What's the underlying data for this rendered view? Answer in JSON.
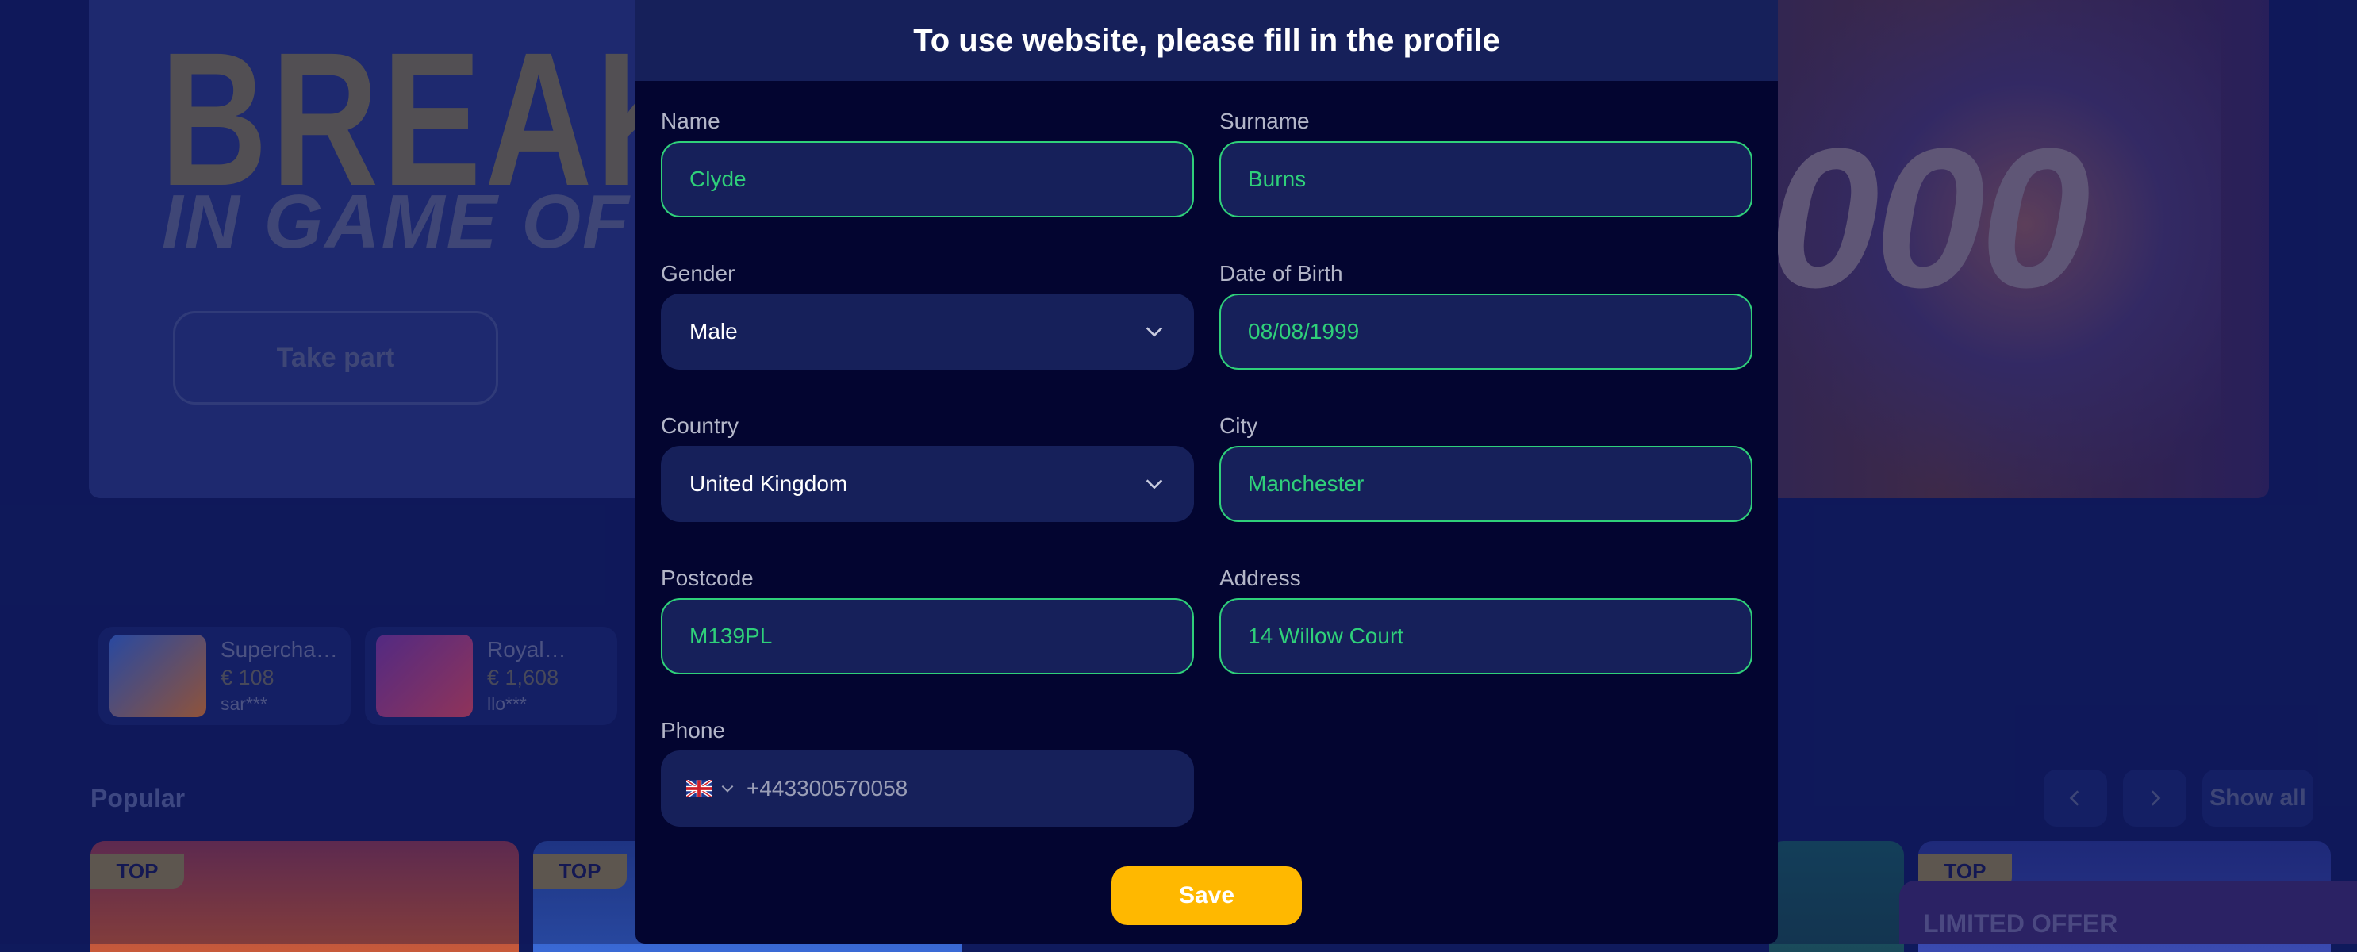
{
  "background": {
    "banner": {
      "title_line1": "BREAK T",
      "title_line2": "IN GAME OF T",
      "cta_label": "Take part",
      "amount_text": "000"
    },
    "winners": [
      {
        "name": "Supercharg…",
        "amount": "€ 108",
        "user": "sar***"
      },
      {
        "name": "Royal…",
        "amount": "€ 1,608",
        "user": "llo***"
      }
    ],
    "popular": {
      "title": "Popular",
      "show_all_label": "Show all",
      "badge_label": "TOP"
    },
    "offer_label": "LIMITED OFFER"
  },
  "modal": {
    "title": "To use website, please fill in the profile",
    "fields": {
      "name": {
        "label": "Name",
        "value": "Clyde"
      },
      "surname": {
        "label": "Surname",
        "value": "Burns"
      },
      "gender": {
        "label": "Gender",
        "value": "Male"
      },
      "dob": {
        "label": "Date of Birth",
        "value": "08/08/1999"
      },
      "country": {
        "label": "Country",
        "value": "United Kingdom"
      },
      "city": {
        "label": "City",
        "value": "Manchester"
      },
      "postcode": {
        "label": "Postcode",
        "value": "M139PL"
      },
      "address": {
        "label": "Address",
        "value": "14 Willow Court"
      },
      "phone": {
        "label": "Phone",
        "value": "+443300570058",
        "country_flag": "uk-flag-icon"
      }
    },
    "save_label": "Save"
  },
  "colors": {
    "accent_green": "#2fd07a",
    "save_yellow": "#ffb800",
    "modal_bg": "#030530",
    "field_bg": "#16205a"
  }
}
